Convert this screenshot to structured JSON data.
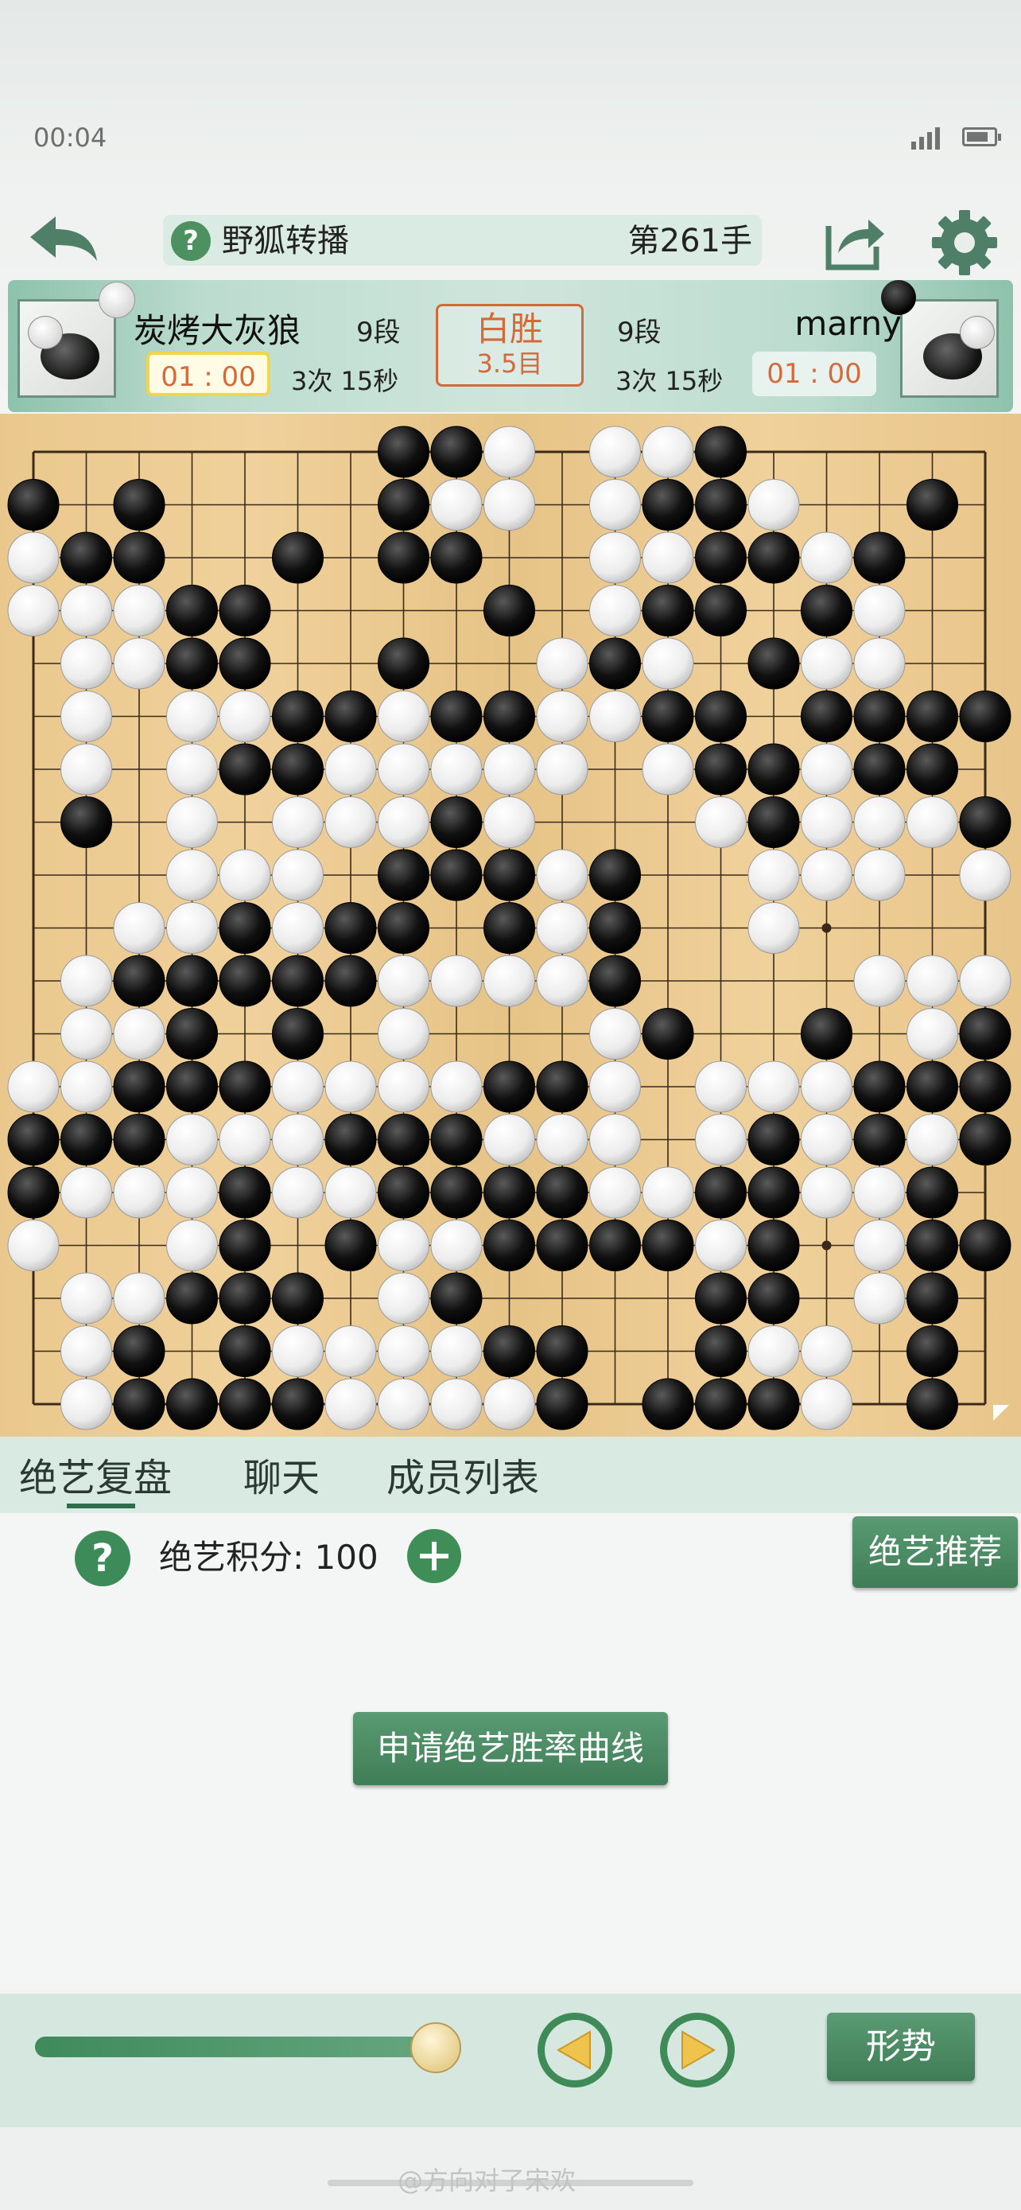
{
  "status_bar": {
    "time": "00:04"
  },
  "header": {
    "help_label": "?",
    "title": "野狐转播",
    "move_number": "第261手",
    "icons": {
      "back": "back-arrow-icon",
      "share": "share-icon",
      "settings": "gear-icon"
    }
  },
  "players": {
    "black": {
      "name": "炭烤大灰狼",
      "rank": "9段",
      "clock": "01 : 00",
      "byoyomi": "3次 15秒"
    },
    "white": {
      "name": "marny",
      "rank": "9段",
      "clock": "01 : 00",
      "byoyomi": "3次 15秒"
    }
  },
  "result": {
    "main": "白胜",
    "sub": "3.5目"
  },
  "board": {
    "size": 19,
    "rows": [
      ".......BBW.WWB.....",
      "B.B....BWW.WBBW..B.",
      "WBB..B.BB..WWBBWB..",
      "WWWBB....B.WBB.BW..",
      ".WWBB..B..WBW.BWW..",
      ".W.WWBBWBBWWBB.BBBB",
      ".W.WBBWWWWW.WBBWBB.",
      ".B.W.WWWBW...WBWWWB",
      "...WWW.BBBWB..WWW.W",
      "..WWBWBB.BWB..W....",
      ".WBBBBBWWWWB....WWW",
      ".WWB.B.W...WB..B.WB",
      "WWBBBWWWWBBW.WWWBBB",
      "BBBWWWBBBWWW.WBWBWB",
      "BWWWBWWBBBBWWBBWWB.",
      "W..WB.BWWBBBBWB.WBB",
      ".WWBBB.WB....BB.WB.",
      ".WB.BWWWWBB..BWW.B.",
      ".WBBBBWWWWB.BBBW.B."
    ],
    "last_move": "T1"
  },
  "tabs": [
    "绝艺复盘",
    "聊天",
    "成员列表"
  ],
  "score": {
    "help_label": "?",
    "label": "绝艺积分: 100"
  },
  "buttons": {
    "recommend": "绝艺推荐",
    "win_curve": "申请绝艺胜率曲线",
    "situation": "形势"
  },
  "watermark": "@方向对了宋欢"
}
